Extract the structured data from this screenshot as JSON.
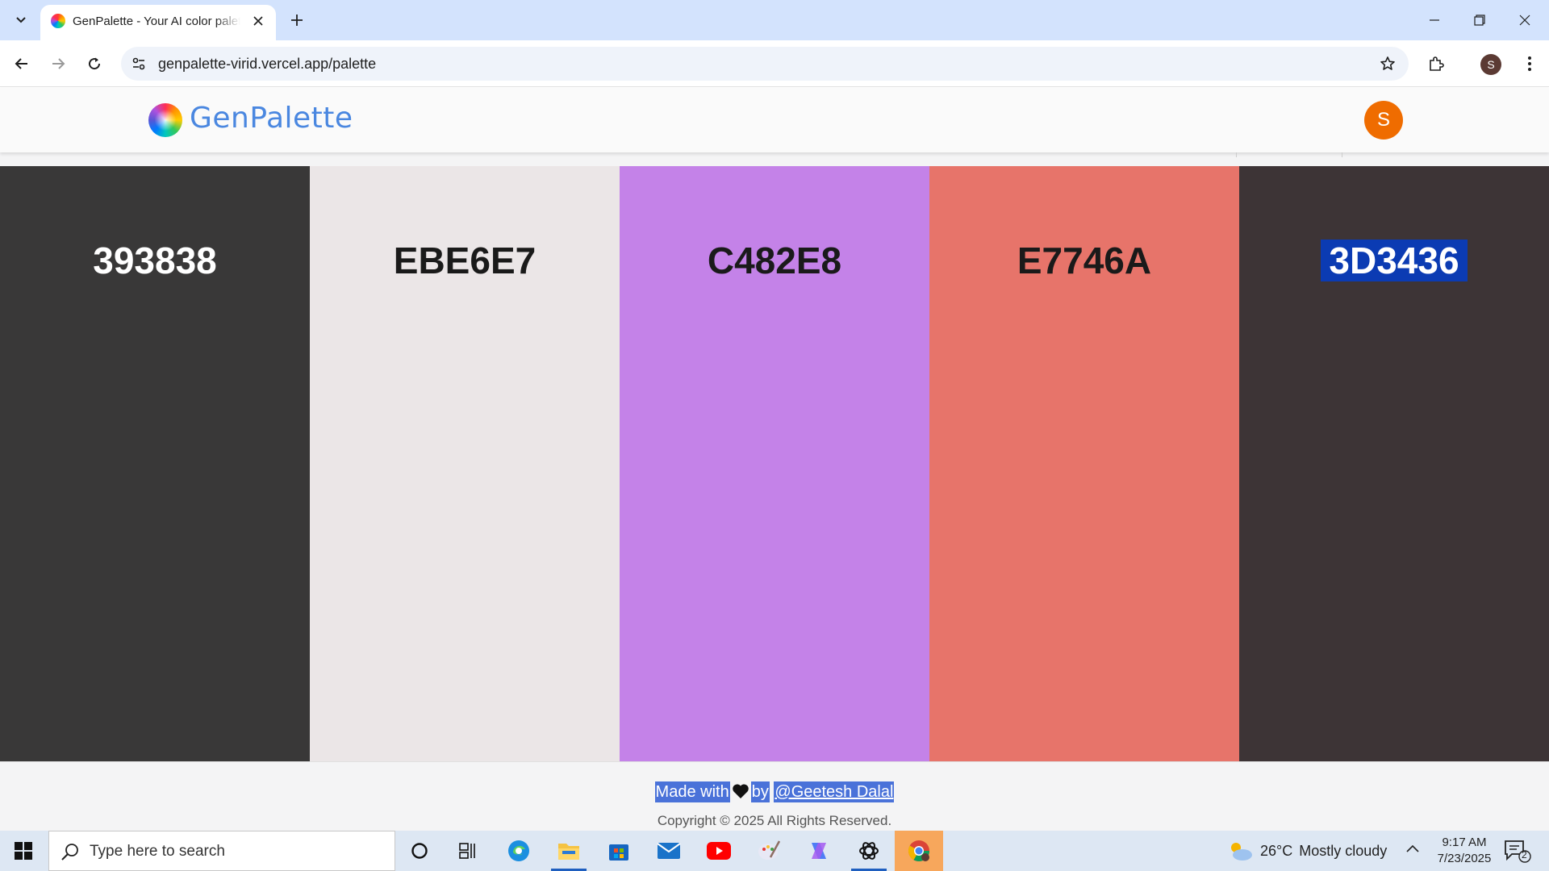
{
  "browser": {
    "tab_title": "GenPalette - Your AI color palette generator",
    "url": "genpalette-virid.vercel.app/palette",
    "profile_initial": "S"
  },
  "site": {
    "logo_text": "GenPalette",
    "user_initial": "S"
  },
  "palette": {
    "colors": [
      {
        "code": "393838",
        "hex": "#393838",
        "text_color": "#ffffff"
      },
      {
        "code": "EBE6E7",
        "hex": "#EBE6E7",
        "text_color": "#1a1a1a"
      },
      {
        "code": "C482E8",
        "hex": "#C482E8",
        "text_color": "#1a1a1a"
      },
      {
        "code": "E7746A",
        "hex": "#E7746A",
        "text_color": "#1a1a1a"
      },
      {
        "code": "3D3436",
        "hex": "#3D3436",
        "text_color": "#ffffff"
      }
    ]
  },
  "footer": {
    "made_with": "Made with",
    "by": "by",
    "author": "@Geetesh Dalal",
    "copyright": "Copyright © 2025 All Rights Reserved."
  },
  "taskbar": {
    "search_placeholder": "Type here to search",
    "weather_temp": "26°C",
    "weather_desc": "Mostly cloudy",
    "time": "9:17 AM",
    "date": "7/23/2025",
    "notification_count": "2"
  },
  "colors": {
    "tab_strip": "#d3e3fd",
    "accent_blue": "#4a87e0",
    "avatar_orange": "#ef6c00",
    "selection": "#0b3bb3"
  }
}
